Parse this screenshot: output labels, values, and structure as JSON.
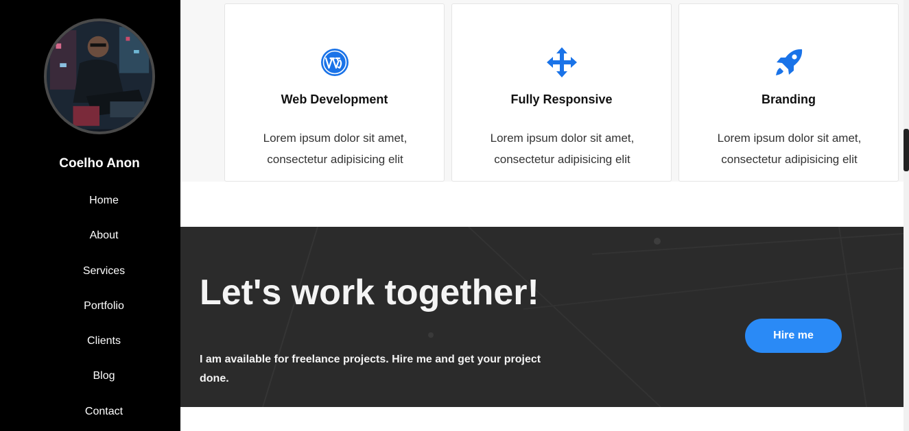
{
  "sidebar": {
    "name": "Coelho Anon",
    "nav": [
      {
        "label": "Home"
      },
      {
        "label": "About"
      },
      {
        "label": "Services"
      },
      {
        "label": "Portfolio"
      },
      {
        "label": "Clients"
      },
      {
        "label": "Blog"
      },
      {
        "label": "Contact"
      }
    ]
  },
  "services": [
    {
      "icon": "wordpress-icon",
      "title": "Web Development",
      "text": "Lorem ipsum dolor sit amet, consectetur adipisicing elit"
    },
    {
      "icon": "arrows-move-icon",
      "title": "Fully Responsive",
      "text": "Lorem ipsum dolor sit amet, consectetur adipisicing elit"
    },
    {
      "icon": "rocket-icon",
      "title": "Branding",
      "text": "Lorem ipsum dolor sit amet, consectetur adipisicing elit"
    }
  ],
  "cta": {
    "title": "Let's work together!",
    "text": "I am available for freelance projects. Hire me and get your project done.",
    "button": "Hire me"
  },
  "colors": {
    "accent": "#2a8af6",
    "icon": "#1a73e8",
    "sidebar_bg": "#000000",
    "cta_bg": "#2b2b2b"
  }
}
